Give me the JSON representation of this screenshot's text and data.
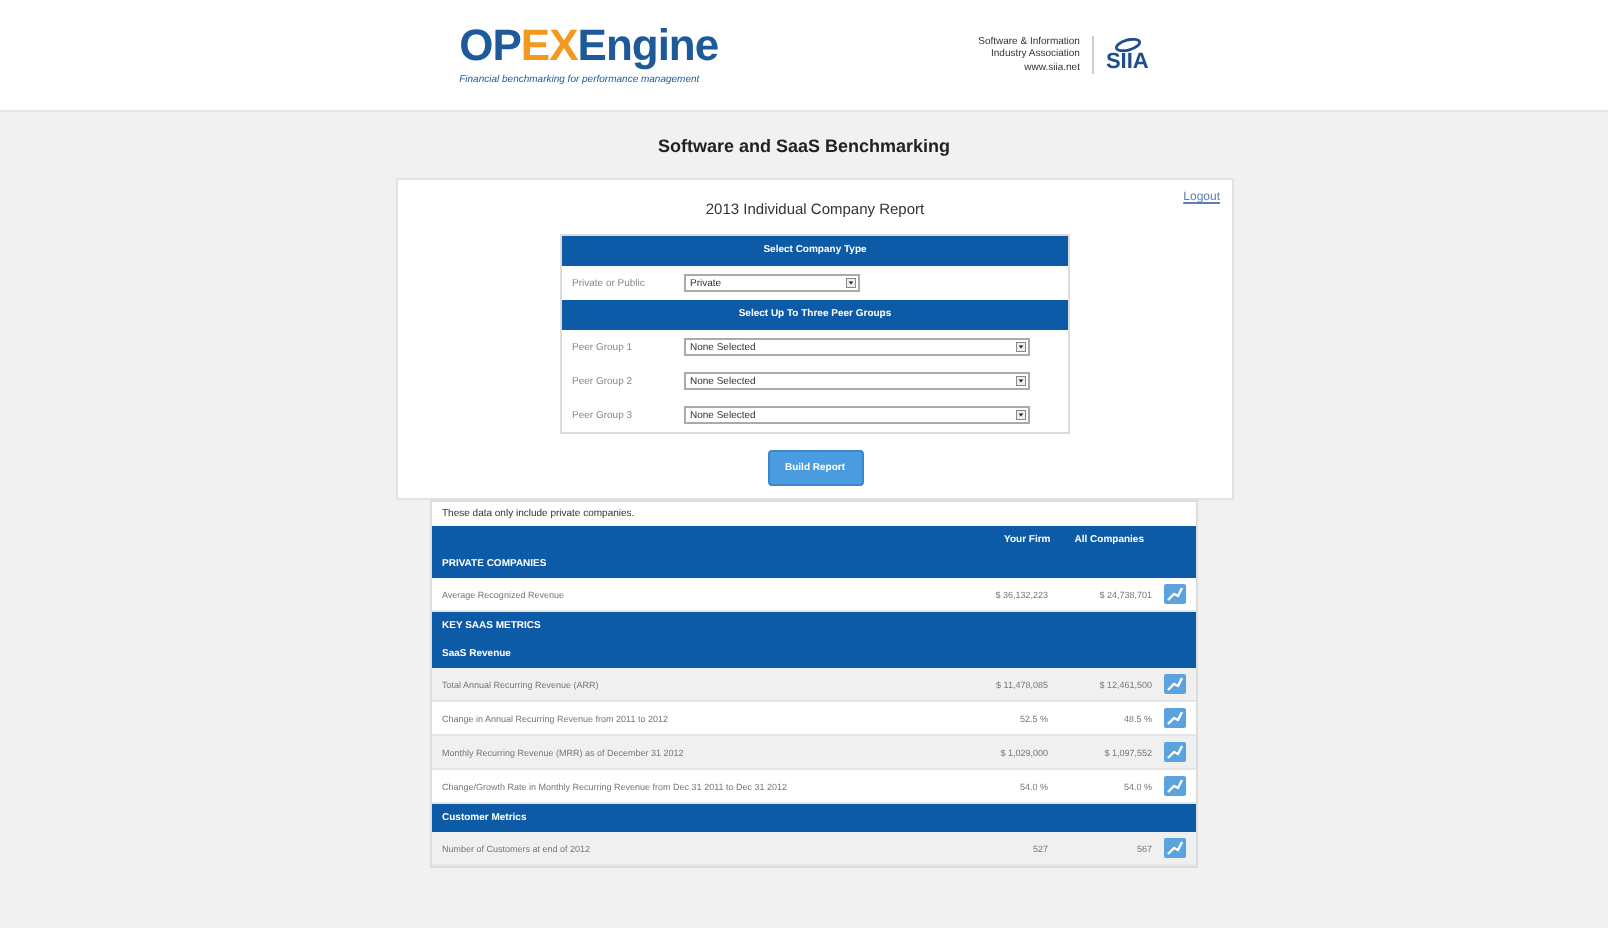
{
  "header": {
    "logo_parts": [
      "OP",
      "EX",
      "Engine"
    ],
    "logo_tagline": "Financial benchmarking for performance management",
    "partner_lines": [
      "Software & Information",
      "Industry Association",
      "www.siia.net"
    ],
    "partner_mark": "SIIA"
  },
  "page_title": "Software and SaaS Benchmarking",
  "report": {
    "logout": "Logout",
    "title": "2013 Individual Company Report",
    "form": {
      "sections": [
        {
          "heading": "Select Company Type",
          "fields": [
            {
              "label": "Private or Public",
              "value": "Private"
            }
          ]
        },
        {
          "heading": "Select Up To Three Peer Groups",
          "fields": [
            {
              "label": "Peer Group 1",
              "value": "None Selected"
            },
            {
              "label": "Peer Group 2",
              "value": "None Selected"
            },
            {
              "label": "Peer Group 3",
              "value": "None Selected"
            }
          ]
        }
      ]
    },
    "build_button": "Build Report"
  },
  "results": {
    "note": "These data only include private companies.",
    "columns": [
      "Your Firm",
      "All Companies"
    ],
    "rows": [
      {
        "kind": "section",
        "label": "PRIVATE COMPANIES"
      },
      {
        "kind": "metric",
        "label": "Average Recognized Revenue",
        "your_firm": "$ 36,132,223",
        "all_companies": "$ 24,738,701"
      },
      {
        "kind": "section",
        "label": "KEY SAAS METRICS"
      },
      {
        "kind": "section",
        "label": "SaaS Revenue"
      },
      {
        "kind": "metric",
        "label": "Total Annual Recurring Revenue (ARR)",
        "your_firm": "$ 11,478,085",
        "all_companies": "$ 12,461,500"
      },
      {
        "kind": "metric",
        "label": "Change in Annual Recurring Revenue from 2011 to 2012",
        "your_firm": "52.5 %",
        "all_companies": "48.5 %"
      },
      {
        "kind": "metric",
        "label": "Monthly Recurring Revenue (MRR) as of December 31 2012",
        "your_firm": "$ 1,029,000",
        "all_companies": "$ 1,097,552"
      },
      {
        "kind": "metric",
        "label": "Change/Growth Rate in Monthly Recurring Revenue from Dec 31 2011 to Dec 31 2012",
        "your_firm": "54.0 %",
        "all_companies": "54.0 %"
      },
      {
        "kind": "section",
        "label": "Customer Metrics"
      },
      {
        "kind": "metric",
        "label": "Number of Customers at end of 2012",
        "your_firm": "527",
        "all_companies": "567"
      }
    ]
  }
}
